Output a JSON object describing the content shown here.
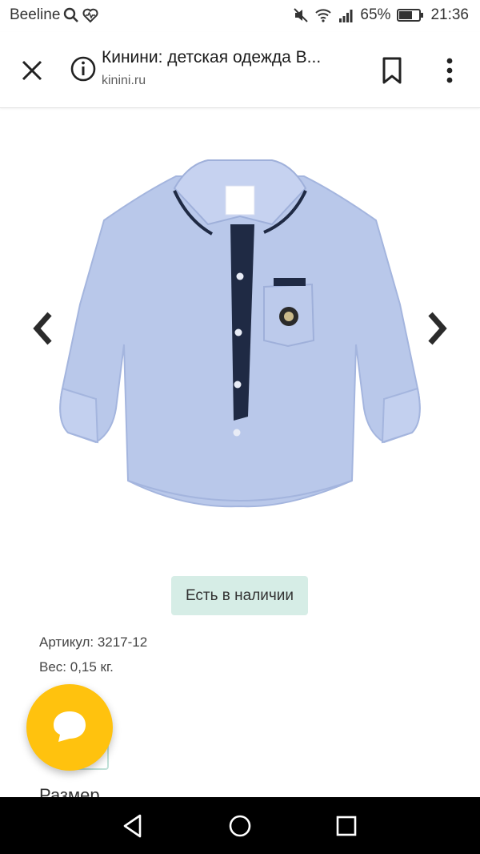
{
  "status_bar": {
    "carrier": "Beeline",
    "battery": "65%",
    "time": "21:36",
    "icons": [
      "search-icon",
      "heart-rate-icon",
      "mute-icon",
      "wifi-icon",
      "signal-icon",
      "battery-icon"
    ]
  },
  "browser": {
    "page_title": "Кинини: детская одежда В...",
    "url": "kinini.ru",
    "icons": [
      "close-icon",
      "info-icon",
      "bookmark-icon",
      "more-vert-icon"
    ]
  },
  "product": {
    "gallery_icons": [
      "chevron-left-icon",
      "chevron-right-icon"
    ],
    "stock_status": "Есть в наличии",
    "article": "Артикул: 3217-12",
    "weight": "Вес: 0,15 кг.",
    "size_heading": "Размер"
  },
  "colors": {
    "stock_badge_bg": "#d6ede6",
    "fab_bg": "#ffc20e",
    "shirt": "#b9c8ea",
    "placket": "#1f2a44"
  },
  "nav_bar": {
    "icons": [
      "back-triangle-icon",
      "home-circle-icon",
      "recent-square-icon"
    ]
  }
}
